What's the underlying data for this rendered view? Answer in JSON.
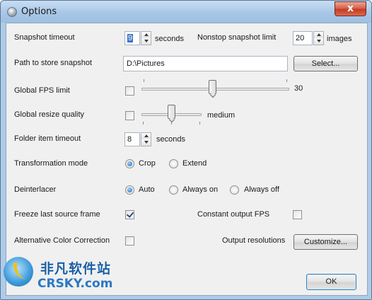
{
  "window": {
    "title": "Options",
    "close_glyph": "x"
  },
  "snapshot_timeout": {
    "label": "Snapshot timeout",
    "value": "9",
    "unit": "seconds"
  },
  "nonstop_limit": {
    "label": "Nonstop snapshot limit",
    "value": "20",
    "unit": "images"
  },
  "path": {
    "label": "Path to store snapshot",
    "value": "D:\\Pictures",
    "select_button": "Select..."
  },
  "fps_limit": {
    "label": "Global FPS limit",
    "checked": false,
    "value": "30",
    "slider_fraction": 0.48
  },
  "resize_quality": {
    "label": "Global resize quality",
    "checked": false,
    "value": "medium",
    "slider_fraction": 0.5
  },
  "folder_timeout": {
    "label": "Folder item timeout",
    "value": "8",
    "unit": "seconds"
  },
  "transformation": {
    "label": "Transformation mode",
    "options": [
      "Crop",
      "Extend"
    ],
    "selected": "Crop"
  },
  "deinterlacer": {
    "label": "Deinterlacer",
    "options": [
      "Auto",
      "Always on",
      "Always off"
    ],
    "selected": "Auto"
  },
  "freeze_last": {
    "label": "Freeze last source frame",
    "checked": true
  },
  "constant_fps": {
    "label": "Constant output FPS",
    "checked": false
  },
  "alt_color": {
    "label": "Alternative Color Correction",
    "checked": false
  },
  "output_res": {
    "label": "Output resolutions",
    "button": "Customize..."
  },
  "ok_button": "OK",
  "watermark": {
    "chinese": "非凡软件站",
    "english": "CRSKY.com"
  },
  "colors": {
    "titlebar": "#aecbe8",
    "dialog_bg": "#f0f0f0",
    "close": "#c9452e",
    "selection": "#3c75c6"
  }
}
